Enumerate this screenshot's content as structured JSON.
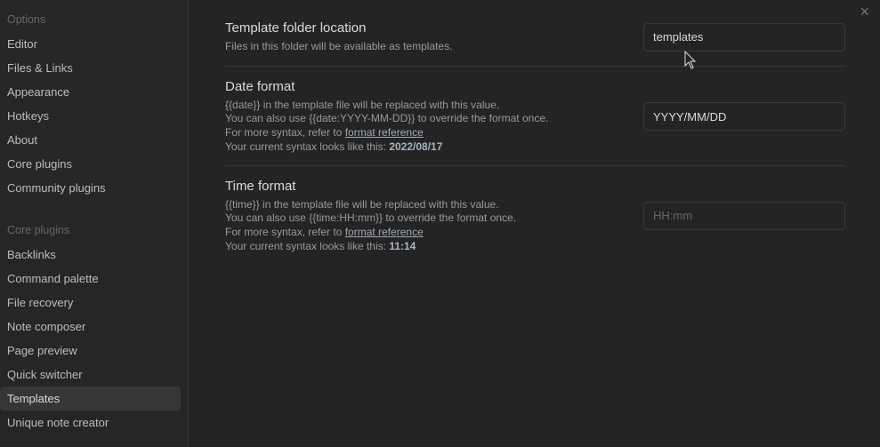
{
  "sidebar": {
    "options_heading": "Options",
    "options": [
      "Editor",
      "Files & Links",
      "Appearance",
      "Hotkeys",
      "About",
      "Core plugins",
      "Community plugins"
    ],
    "core_heading": "Core plugins",
    "core": [
      "Backlinks",
      "Command palette",
      "File recovery",
      "Note composer",
      "Page preview",
      "Quick switcher",
      "Templates",
      "Unique note creator"
    ],
    "active": "Templates"
  },
  "settings": {
    "folder": {
      "title": "Template folder location",
      "desc": "Files in this folder will be available as templates.",
      "value": "templates"
    },
    "date": {
      "title": "Date format",
      "line1": "{{date}} in the template file will be replaced with this value.",
      "line2": "You can also use {{date:YYYY-MM-DD}} to override the format once.",
      "line3": "For more syntax, refer to ",
      "link": "format reference",
      "line4": "Your current syntax looks like this: ",
      "example": "2022/08/17",
      "value": "YYYY/MM/DD"
    },
    "time": {
      "title": "Time format",
      "line1": "{{time}} in the template file will be replaced with this value.",
      "line2": "You can also use {{time:HH:mm}} to override the format once.",
      "line3": "For more syntax, refer to ",
      "link": "format reference",
      "line4": "Your current syntax looks like this: ",
      "example": "11:14",
      "placeholder": "HH:mm"
    }
  },
  "close_icon": "×"
}
